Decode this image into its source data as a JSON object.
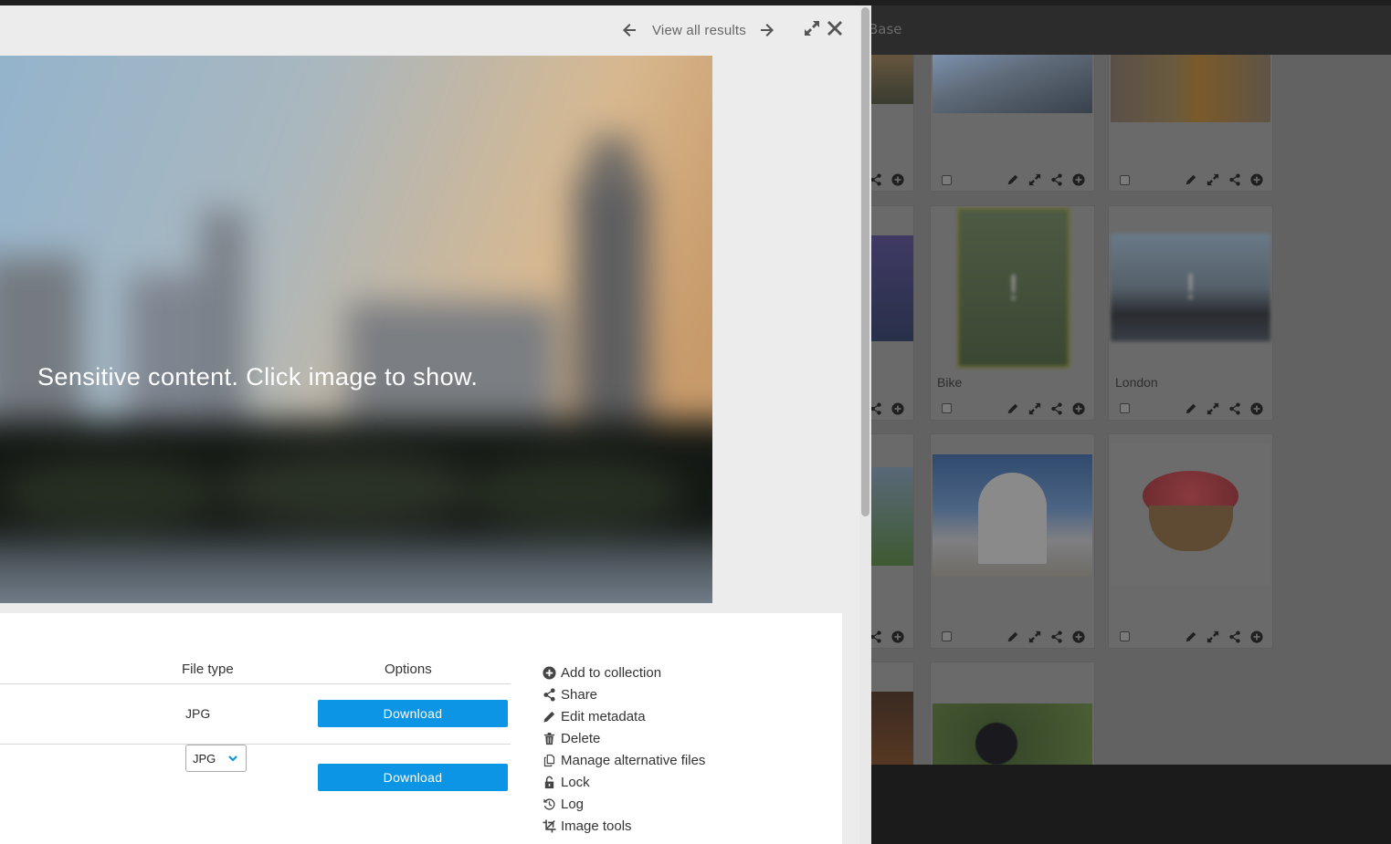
{
  "background": {
    "brand_fragment": "Base",
    "tiles": [
      {
        "caption": ""
      },
      {
        "caption": ""
      },
      {
        "caption": "Bike"
      },
      {
        "caption": "London"
      },
      {
        "caption": ""
      },
      {
        "caption": ""
      },
      {
        "caption": ""
      }
    ],
    "sensitive_marker": "!"
  },
  "modal": {
    "nav": {
      "view_all_label": "View all results"
    },
    "preview": {
      "sensitive_text": "Sensitive content. Click image to show."
    },
    "downloads": {
      "headers": {
        "file_type": "File type",
        "options": "Options"
      },
      "rows": [
        {
          "file_type": "JPG",
          "button_label": "Download"
        },
        {
          "file_type_selected": "JPG",
          "button_label": "Download"
        }
      ]
    },
    "actions": [
      {
        "label": "Add to collection",
        "icon": "plus-circle-icon"
      },
      {
        "label": "Share",
        "icon": "share-icon"
      },
      {
        "label": "Edit metadata",
        "icon": "pencil-icon"
      },
      {
        "label": "Delete",
        "icon": "trash-icon"
      },
      {
        "label": "Manage alternative files",
        "icon": "files-icon"
      },
      {
        "label": "Lock",
        "icon": "unlock-icon"
      },
      {
        "label": "Log",
        "icon": "history-icon"
      },
      {
        "label": "Image tools",
        "icon": "crop-icon"
      }
    ]
  },
  "colors": {
    "accent": "#0c95e4",
    "modal_bg": "#ececec",
    "overlay_dim": "#626262"
  }
}
